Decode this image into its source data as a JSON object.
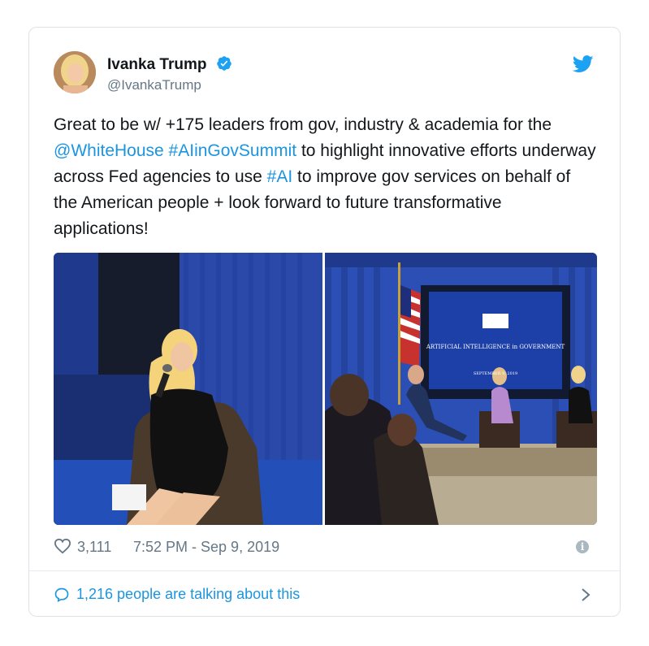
{
  "author": {
    "name": "Ivanka Trump",
    "handle": "@IvankaTrump"
  },
  "tweet": {
    "segments": [
      {
        "text": "Great to be w/ +175 leaders from gov, industry & academia for the ",
        "link": false
      },
      {
        "text": "@WhiteHouse",
        "link": true
      },
      {
        "text": " ",
        "link": false
      },
      {
        "text": "#AIinGovSummit",
        "link": true
      },
      {
        "text": " to highlight innovative efforts underway across Fed agencies to use ",
        "link": false
      },
      {
        "text": "#AI",
        "link": true
      },
      {
        "text": " to improve gov services on behalf of the American people + look forward to future transformative applications!",
        "link": false
      }
    ]
  },
  "media": {
    "screen_title": "ARTIFICIAL INTELLIGENCE in GOVERNMENT",
    "screen_date": "SEPTEMBER 9, 2019"
  },
  "meta": {
    "likes": "3,111",
    "timestamp": "7:52 PM - Sep 9, 2019"
  },
  "footer": {
    "talking": "1,216 people are talking about this"
  },
  "colors": {
    "link": "#1b95e0",
    "muted": "#657786",
    "stage_blue": "#1d3fa8"
  },
  "icons": [
    "verified-icon",
    "twitter-bird-icon",
    "heart-icon",
    "info-icon",
    "comment-bubble-icon",
    "chevron-right-icon"
  ]
}
